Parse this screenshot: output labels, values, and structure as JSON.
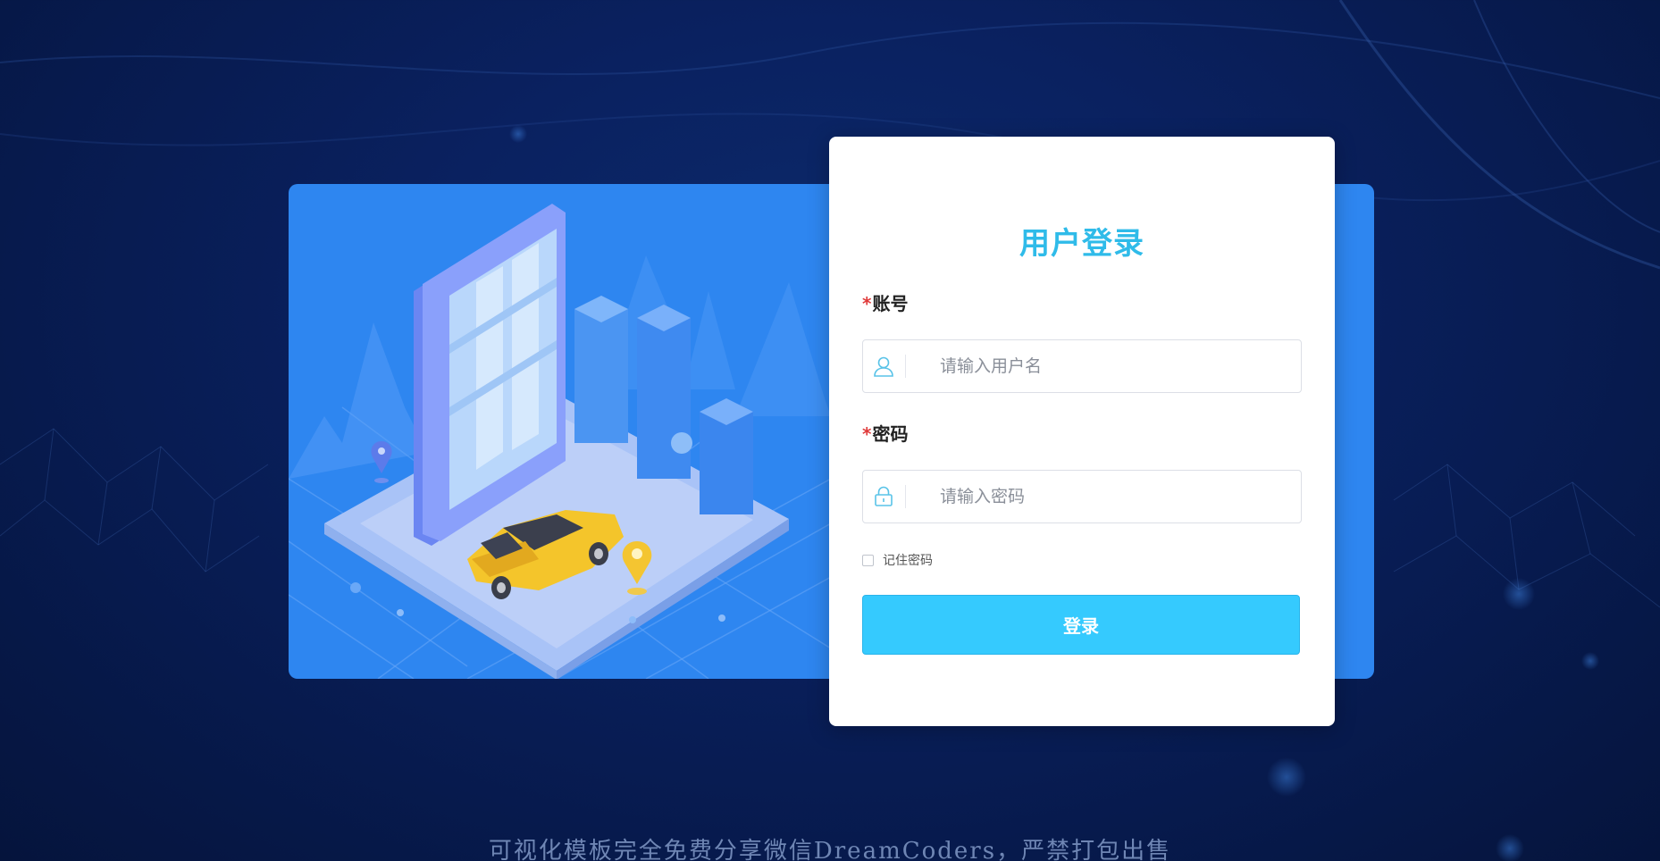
{
  "login": {
    "title": "用户登录",
    "required_mark": "*",
    "account": {
      "label": "账号",
      "placeholder": "请输入用户名",
      "icon": "user-icon"
    },
    "password": {
      "label": "密码",
      "placeholder": "请输入密码",
      "icon": "lock-icon"
    },
    "remember_label": "记住密码",
    "remember_checked": false,
    "submit_label": "登录"
  },
  "footer": {
    "note": "可视化模板完全免费分享微信DreamCoders，严禁打包出售"
  },
  "colors": {
    "background": "#0a2160",
    "hero_panel": "#2e86f0",
    "title": "#2fbbe9",
    "button": "#35cafe",
    "required": "#e03a3a"
  }
}
